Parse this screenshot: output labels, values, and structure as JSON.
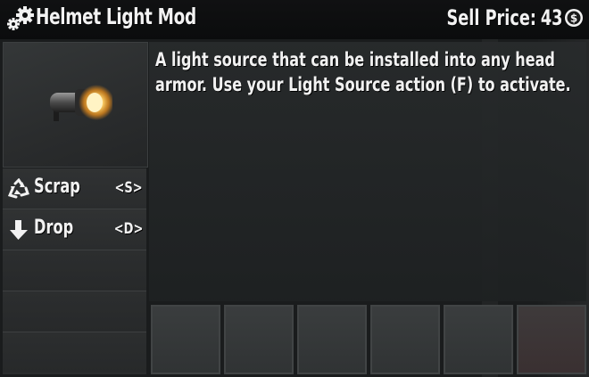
{
  "title": "Helmet Light Mod",
  "sell_price": {
    "label": "Sell Price:",
    "value": "43"
  },
  "icons": {
    "title": "gears-icon",
    "currency": "coin-icon",
    "item": "helmet-light-icon"
  },
  "description": "A light source that can be installed into any head armor. Use your Light Source action (F) to activate.",
  "actions": [
    {
      "label": "Scrap",
      "key": "<S>",
      "icon": "recycle-icon"
    },
    {
      "label": "Drop",
      "key": "<D>",
      "icon": "arrow-down-icon"
    }
  ],
  "colors": {
    "accent_light": "#f7b53a",
    "text": "#f2f2f2"
  }
}
